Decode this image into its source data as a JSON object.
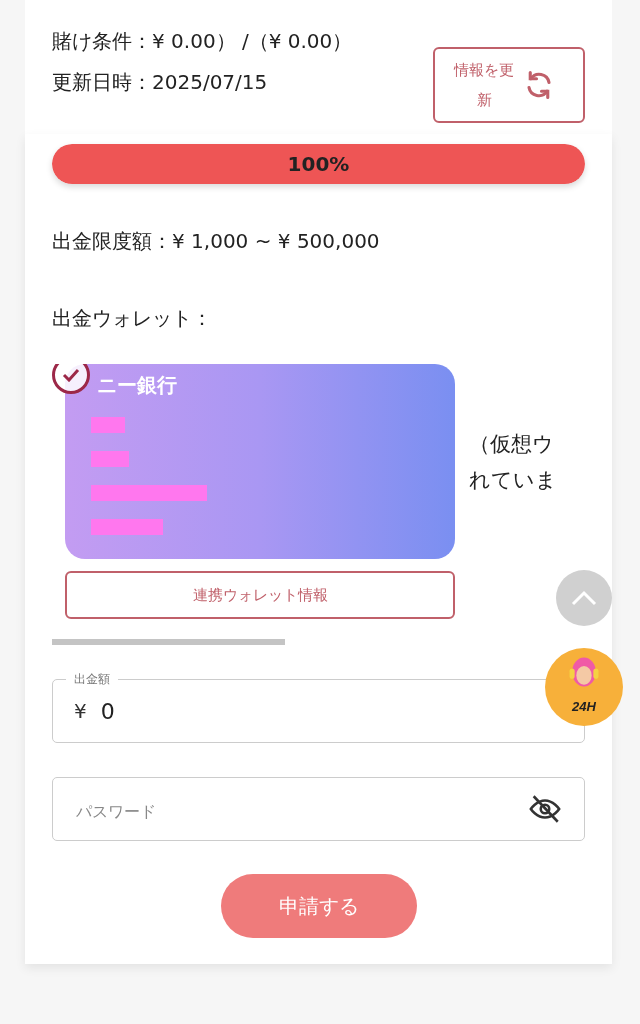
{
  "wager": {
    "text": "賭け条件：¥ 0.00） /（¥ 0.00）"
  },
  "updated": {
    "text": "更新日時：2025/07/15"
  },
  "refresh_button": {
    "label": "情報を更新"
  },
  "progress": {
    "label": "100%",
    "level": 1
  },
  "limit": {
    "text": "出金限度額：¥ 1,000 ~ ¥ 500,000"
  },
  "wallet_heading": "出金ウォレット：",
  "wallets": [
    {
      "kind": "bank",
      "name": "ニー銀行",
      "selected": true
    },
    {
      "kind": "crypto",
      "lines": [
        "（仮想ウ",
        "れていま"
      ],
      "selected": false
    }
  ],
  "wallet_info_button": "連携ウォレット情報",
  "amount_field": {
    "label": "出金額",
    "currency": "¥",
    "value": "0"
  },
  "password_field": {
    "placeholder": "パスワード"
  },
  "submit_button": "申請する",
  "support_badge": "24H"
}
